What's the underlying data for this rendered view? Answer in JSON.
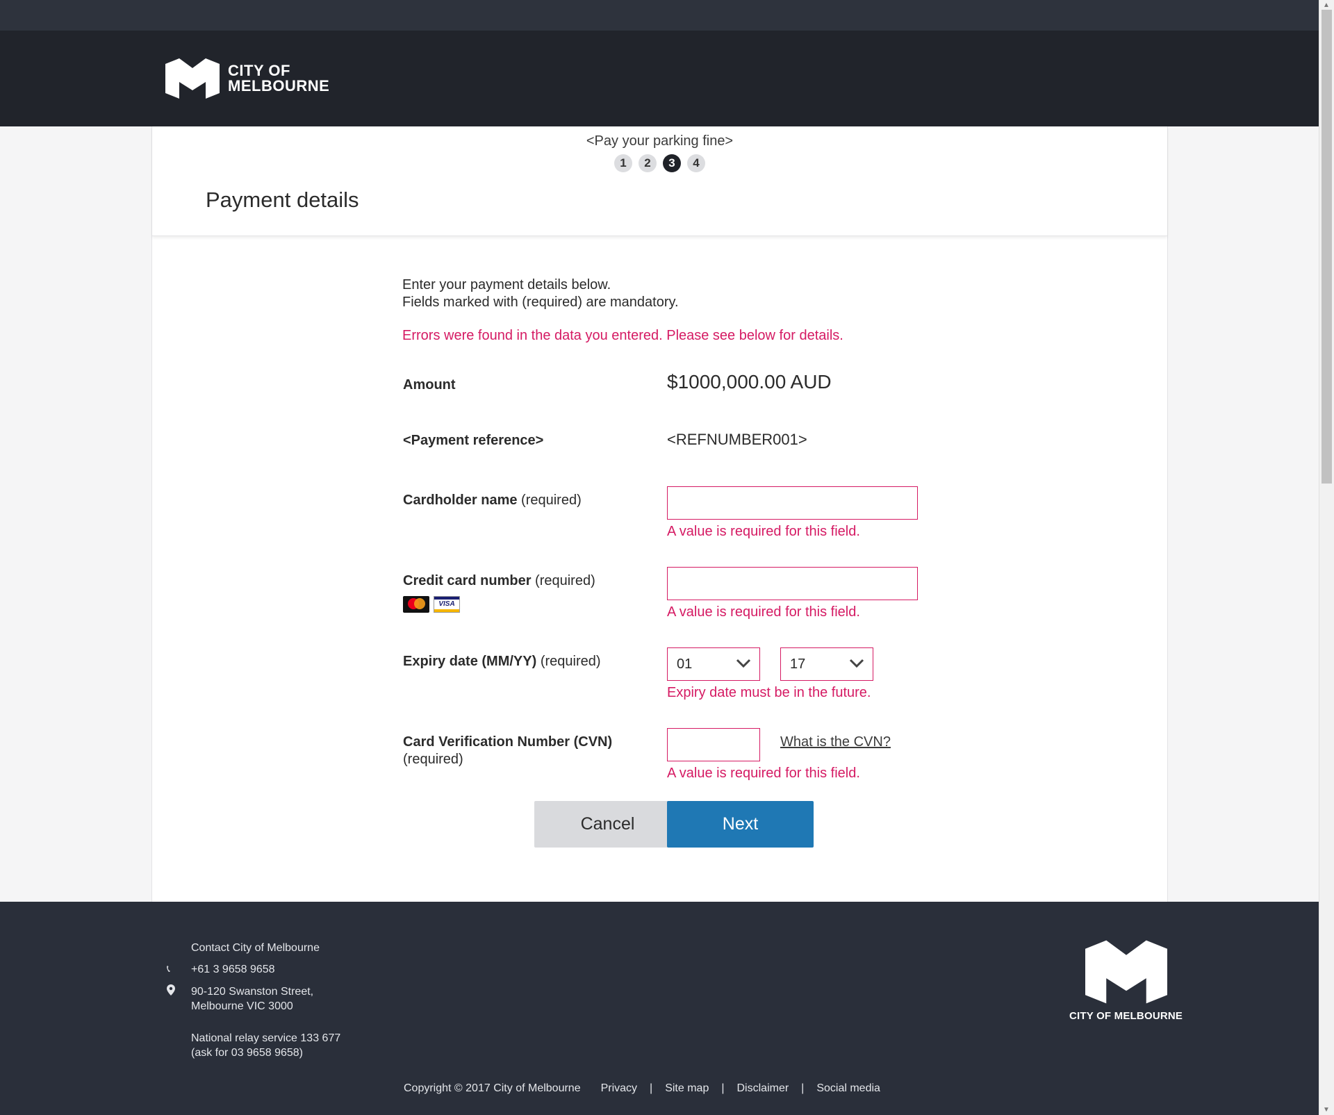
{
  "header": {
    "logo_text_line1": "CITY OF",
    "logo_text_line2": "MELBOURNE",
    "logo_icon": "melbourne-m-icon"
  },
  "flow": {
    "title": "<Pay your parking fine>",
    "steps": [
      "1",
      "2",
      "3",
      "4"
    ],
    "active_step": "3"
  },
  "page_title": "Payment details",
  "intro": {
    "line1": "Enter your payment details below.",
    "line2": "Fields marked with (required) are mandatory."
  },
  "error_summary": "Errors were found in the data you entered. Please see below for details.",
  "amount": {
    "label": "Amount",
    "value": "$1000,000.00 AUD"
  },
  "reference": {
    "label": "<Payment reference>",
    "value": "<REFNUMBER001>"
  },
  "cardholder": {
    "label": "Cardholder name",
    "required": "(required)",
    "value": "",
    "error": "A value is required for this field."
  },
  "card_number": {
    "label": "Credit card number",
    "required": "(required)",
    "value": "",
    "error": "A value is required for this field.",
    "card_icons": [
      "mastercard-icon",
      "visa-icon"
    ],
    "visa_text": "VISA"
  },
  "expiry": {
    "label": "Expiry date (MM/YY)",
    "required": "(required)",
    "month": "01",
    "year": "17",
    "error": "Expiry date must be in the future."
  },
  "cvn": {
    "label": "Card Verification Number (CVN)",
    "required": "(required)",
    "value": "",
    "help_link": "What is the CVN?",
    "error": "A value is required for this field."
  },
  "buttons": {
    "cancel": "Cancel",
    "next": "Next"
  },
  "footer": {
    "contact_title": "Contact City of Melbourne",
    "phone": "+61 3 9658 9658",
    "address_line1": "90-120 Swanston Street,",
    "address_line2": "Melbourne VIC 3000",
    "relay_line1": "National relay service 133 677",
    "relay_line2": "(ask for 03 9658 9658)",
    "logo_text": "CITY OF MELBOURNE",
    "copyright": "Copyright © 2017 City of Melbourne",
    "links": [
      "Privacy",
      "Site map",
      "Disclaimer",
      "Social media"
    ],
    "separator": "|"
  },
  "colors": {
    "header_bg": "#21242b",
    "error": "#d51a63",
    "primary_button": "#1f78b4",
    "footer_bg": "#2a2f3a"
  }
}
